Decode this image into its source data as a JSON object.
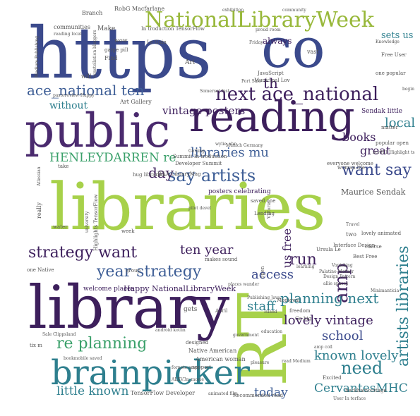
{
  "palette": {
    "navy": "#3b4a8c",
    "purple": "#4a2a6e",
    "deep_purple": "#3d1f5c",
    "lime": "#a7d14a",
    "teal": "#2e7f8e",
    "green": "#3aa06a",
    "olive": "#98b83a",
    "blue": "#3e5e96",
    "grey": "#555555"
  },
  "words": [
    {
      "text": "https",
      "color": "navy"
    },
    {
      "text": "co",
      "color": "navy"
    },
    {
      "text": "NationalLibraryWeek",
      "color": "olive"
    },
    {
      "text": "public",
      "color": "purple"
    },
    {
      "text": "reading",
      "color": "deep_purple"
    },
    {
      "text": "libraries",
      "color": "lime"
    },
    {
      "text": "library",
      "color": "deep_purple"
    },
    {
      "text": "RT",
      "color": "lime"
    },
    {
      "text": "brainpicker",
      "color": "teal"
    },
    {
      "text": "next ace_national",
      "color": "deep_purple"
    },
    {
      "text": "ace_national ten",
      "color": "blue"
    },
    {
      "text": "say artists",
      "color": "blue"
    },
    {
      "text": "want say",
      "color": "navy"
    },
    {
      "text": "strategy want",
      "color": "deep_purple"
    },
    {
      "text": "year strategy",
      "color": "blue"
    },
    {
      "text": "re planning",
      "color": "green"
    },
    {
      "text": "planning next",
      "color": "teal"
    },
    {
      "text": "lovely vintage",
      "color": "deep_purple"
    },
    {
      "text": "artists libraries",
      "color": "teal"
    },
    {
      "text": "need",
      "color": "teal"
    },
    {
      "text": "known lovely",
      "color": "teal"
    },
    {
      "text": "CervantesMHC",
      "color": "teal"
    },
    {
      "text": "little known",
      "color": "teal"
    },
    {
      "text": "today",
      "color": "blue"
    },
    {
      "text": "school",
      "color": "navy"
    },
    {
      "text": "staff",
      "color": "teal"
    },
    {
      "text": "access",
      "color": "navy"
    },
    {
      "text": "amp",
      "color": "deep_purple"
    },
    {
      "text": "run",
      "color": "deep_purple"
    },
    {
      "text": "us free",
      "color": "deep_purple"
    },
    {
      "text": "ten year",
      "color": "deep_purple"
    },
    {
      "text": "day",
      "color": "deep_purple"
    },
    {
      "text": "libraries mu",
      "color": "blue"
    },
    {
      "text": "HENLEYDARREN re",
      "color": "green"
    },
    {
      "text": "vintage posters",
      "color": "deep_purple"
    },
    {
      "text": "without",
      "color": "teal"
    },
    {
      "text": "local",
      "color": "teal"
    },
    {
      "text": "books",
      "color": "deep_purple"
    },
    {
      "text": "great",
      "color": "deep_purple"
    },
    {
      "text": "sets us",
      "color": "teal"
    },
    {
      "text": "always",
      "color": "deep_purple"
    },
    {
      "text": "th",
      "color": "deep_purple"
    },
    {
      "text": "Sendak little",
      "color": "deep_purple"
    },
    {
      "text": "Maurice Sendak",
      "color": "grey"
    },
    {
      "text": "Happy NationalLibraryWeek",
      "color": "deep_purple"
    },
    {
      "text": "welcome places",
      "color": "deep_purple"
    },
    {
      "text": "posters celebrating",
      "color": "deep_purple"
    },
    {
      "text": "Native American",
      "color": "grey"
    },
    {
      "text": "American woman",
      "color": "grey"
    },
    {
      "text": "TensorFlow Developer",
      "color": "grey"
    },
    {
      "text": "Recommended read",
      "color": "grey"
    },
    {
      "text": "beckhamcottage",
      "color": "grey"
    },
    {
      "text": "lovely animated",
      "color": "grey"
    },
    {
      "text": "Interface Design",
      "color": "grey"
    },
    {
      "text": "Best Free",
      "color": "grey"
    },
    {
      "text": "Art Gallery",
      "color": "grey"
    },
    {
      "text": "JavaScript",
      "color": "grey"
    },
    {
      "text": "Municipal Lov",
      "color": "grey"
    },
    {
      "text": "Summit In troduction",
      "color": "grey"
    },
    {
      "text": "Developer Summit",
      "color": "grey"
    },
    {
      "text": "IFLA LibraryMag",
      "color": "grey"
    },
    {
      "text": "one popular",
      "color": "grey"
    },
    {
      "text": "Free User",
      "color": "grey"
    },
    {
      "text": "Branch",
      "color": "grey"
    },
    {
      "text": "RobG Macfarlane",
      "color": "grey"
    },
    {
      "text": "exhibition",
      "color": "grey"
    },
    {
      "text": "community",
      "color": "grey"
    },
    {
      "text": "In troduction TensorFlow",
      "color": "grey"
    },
    {
      "text": "Le Guin",
      "color": "grey"
    },
    {
      "text": "Make",
      "color": "grey"
    },
    {
      "text": "communities",
      "color": "grey"
    },
    {
      "text": "reading local",
      "color": "grey"
    },
    {
      "text": "saved one",
      "color": "grey"
    },
    {
      "text": "Lending",
      "color": "grey"
    },
    {
      "text": "Ursula Le",
      "color": "grey"
    },
    {
      "text": "Publishing Java",
      "color": "grey"
    },
    {
      "text": "Medieval",
      "color": "grey"
    },
    {
      "text": "freedom",
      "color": "grey"
    },
    {
      "text": "Go big",
      "color": "grey"
    },
    {
      "text": "learning",
      "color": "grey"
    },
    {
      "text": "government",
      "color": "grey"
    },
    {
      "text": "designed",
      "color": "grey"
    },
    {
      "text": "gets",
      "color": "grey"
    },
    {
      "text": "hug librarian",
      "color": "grey"
    },
    {
      "text": "everyone welcome",
      "color": "grey"
    },
    {
      "text": "woman life",
      "color": "grey"
    },
    {
      "text": "popular open",
      "color": "grey"
    },
    {
      "text": "matter",
      "color": "grey"
    },
    {
      "text": "Knowledge",
      "color": "grey"
    },
    {
      "text": "Excited",
      "color": "grey"
    },
    {
      "text": "read Medium",
      "color": "grey"
    },
    {
      "text": "amp coll",
      "color": "grey"
    },
    {
      "text": "pleasure",
      "color": "grey"
    },
    {
      "text": "animated film",
      "color": "grey"
    },
    {
      "text": "User In terface",
      "color": "grey"
    },
    {
      "text": "android kotlin",
      "color": "grey"
    },
    {
      "text": "bookmobile saved",
      "color": "grey"
    },
    {
      "text": "Sale Clippsland",
      "color": "grey"
    },
    {
      "text": "Munich Germany",
      "color": "grey"
    },
    {
      "text": "pilot devel",
      "color": "grey"
    },
    {
      "text": "Getting",
      "color": "grey"
    },
    {
      "text": "wylie_ahn",
      "color": "grey"
    },
    {
      "text": "Highlights TensorFlow",
      "color": "grey"
    },
    {
      "text": "zcv911 Highlight ts",
      "color": "grey"
    },
    {
      "text": "course",
      "color": "grey"
    },
    {
      "text": "open",
      "color": "grey"
    },
    {
      "text": "two",
      "color": "grey"
    },
    {
      "text": "Travel",
      "color": "grey"
    },
    {
      "text": "Port Sale",
      "color": "grey"
    },
    {
      "text": "Friday",
      "color": "grey"
    },
    {
      "text": "vast",
      "color": "grey"
    },
    {
      "text": "proud room",
      "color": "grey"
    },
    {
      "text": "wow",
      "color": "grey"
    },
    {
      "text": "Find",
      "color": "grey"
    },
    {
      "text": "will",
      "color": "grey"
    },
    {
      "text": "Art",
      "color": "grey"
    },
    {
      "text": "take",
      "color": "grey"
    },
    {
      "text": "really",
      "color": "grey"
    },
    {
      "text": "water",
      "color": "grey"
    },
    {
      "text": "week",
      "color": "grey"
    },
    {
      "text": "group",
      "color": "grey"
    },
    {
      "text": "one Native",
      "color": "grey"
    },
    {
      "text": "makes sound",
      "color": "grey"
    },
    {
      "text": "places wander",
      "color": "grey"
    },
    {
      "text": "April",
      "color": "grey"
    },
    {
      "text": "Island",
      "color": "grey"
    },
    {
      "text": "Minimanticia",
      "color": "grey"
    },
    {
      "text": "gatge pill",
      "color": "grey"
    },
    {
      "text": "pastoreview Happy",
      "color": "grey"
    },
    {
      "text": "Somerset fest",
      "color": "grey"
    },
    {
      "text": "begin",
      "color": "grey"
    },
    {
      "text": "ALEV3n_movie",
      "color": "grey"
    },
    {
      "text": "fornote amp",
      "color": "grey"
    },
    {
      "text": "support",
      "color": "grey"
    },
    {
      "text": "tix m",
      "color": "grey"
    },
    {
      "text": "Palatino Mother",
      "color": "grey"
    },
    {
      "text": "Design Pattern",
      "color": "grey"
    },
    {
      "text": "allie spaces",
      "color": "grey"
    },
    {
      "text": "education",
      "color": "grey"
    },
    {
      "text": "Vanishing",
      "color": "grey"
    },
    {
      "text": "Atlassian",
      "color": "grey"
    },
    {
      "text": "Medium Publishing",
      "color": "grey"
    },
    {
      "text": "constellation bloggers",
      "color": "grey"
    },
    {
      "text": "university",
      "color": "grey"
    },
    {
      "text": "Victoria",
      "color": "grey"
    }
  ]
}
